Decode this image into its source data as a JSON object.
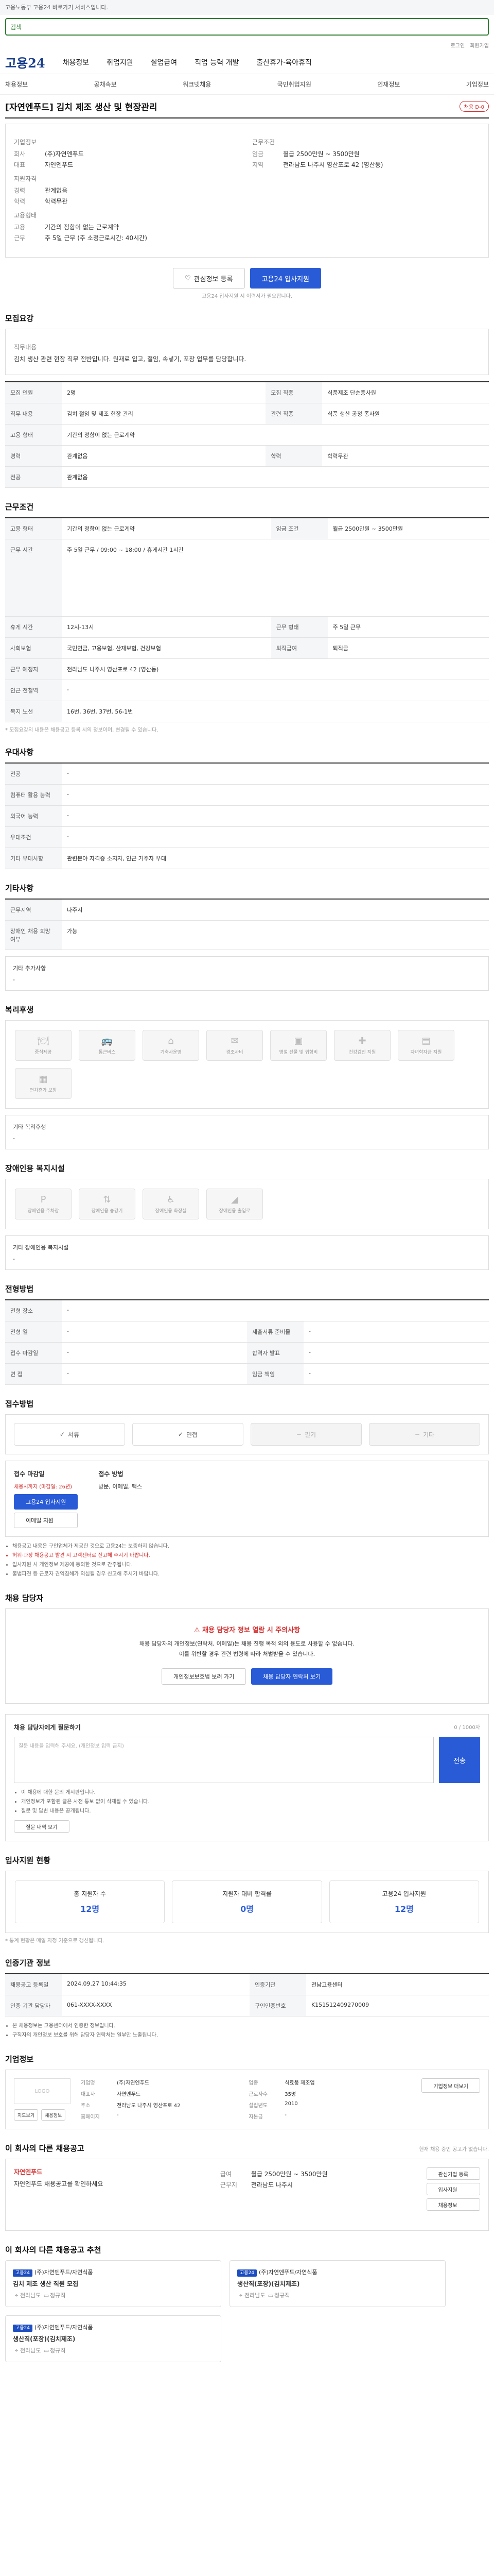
{
  "topbar": {
    "text": "고용노동부 고용24 바로가기 서비스입니다."
  },
  "search": {
    "placeholder": "검색"
  },
  "util": {
    "links": [
      "로그인",
      "회원가입"
    ]
  },
  "brand": {
    "logo": "고용24",
    "nav": [
      "채용정보",
      "취업지원",
      "실업급여",
      "직업 능력 개발",
      "출산휴가·육아휴직"
    ]
  },
  "subnav": [
    "채용정보",
    "공채속보",
    "워크넷채용",
    "국민취업지원",
    "인재정보",
    "기업정보"
  ],
  "job": {
    "title": "[자연엔푸드] 김치 제조 생산 및 현장관리",
    "badge": "채용 D-0",
    "company_label": "기업정보",
    "company_rows": [
      {
        "k": "회사",
        "v": "(주)자연엔푸드"
      },
      {
        "k": "대표",
        "v": "자연엔푸드"
      }
    ],
    "terms_label": "근무조건",
    "terms_rows": [
      {
        "k": "임금",
        "v": "월급 2500만원 ~ 3500만원"
      },
      {
        "k": "지역",
        "v": "전라남도 나주시 영산포로 42 (영산동)"
      }
    ],
    "req_label": "지원자격",
    "req_rows": [
      {
        "k": "경력",
        "v": "관계없음"
      },
      {
        "k": "학력",
        "v": "학력무관"
      }
    ],
    "welfare_label": "고용형태",
    "welfare_rows": [
      {
        "k": "고용",
        "v": "기간의 정함이 없는 근로계약"
      },
      {
        "k": "근무",
        "v": "주 5일 근무 (주 소정근로시간: 40시간)"
      }
    ],
    "scrap_btn": "관심정보 등록",
    "apply_btn": "고용24 입사지원",
    "apply_note": "고용24 입사지원 시 이력서가 필요합니다."
  },
  "sections": {
    "recruit": "모집요강",
    "conditions": "근무조건",
    "benefits": "우대사항",
    "etc": "기타사항",
    "welfare": "복리후생",
    "disability": "장애인용 복지시설",
    "process": "전형방법",
    "method": "접수방법",
    "contact": "채용 담당자",
    "stats": "입사지원 현황",
    "cert": "인증기관 정보",
    "company": "기업정보",
    "other": "이 회사의 다른 채용공고",
    "recommend": "이 회사의 다른 채용공고 추천"
  },
  "recruit": {
    "job_type_label": "직무내용",
    "job_desc": "김치 생산 관련 현장 직무 전반입니다. 원재료 입고, 절임, 속넣기, 포장 업무를 담당합니다.",
    "rows": [
      {
        "k": "모집 인원",
        "v": "2명",
        "k2": "모집 직종",
        "v2": "식품제조 단순종사원"
      },
      {
        "k": "직무 내용",
        "v": "김치 절임 및 제조 현장 관리",
        "k2": "관련 직종",
        "v2": "식품 생산 공정 종사원"
      },
      {
        "k": "고용 형태",
        "v": "기간의 정함이 없는 근로계약"
      },
      {
        "k": "경력",
        "v": "관계없음",
        "k2": "학력",
        "v2": "학력무관"
      },
      {
        "k": "전공",
        "v": "관계없음"
      }
    ]
  },
  "conditions": {
    "rows": [
      {
        "k": "고용 형태",
        "v": "기간의 정함이 없는 근로계약",
        "k2": "임금 조건",
        "v2": "월급 2500만원 ~ 3500만원"
      },
      {
        "k": "근무 시간",
        "v": "주 5일 근무 / 09:00 ~ 18:00 / 휴게시간 1시간"
      },
      {
        "k": "휴게 시간",
        "v": "12시-13시",
        "k2": "근무 형태",
        "v2": "주 5일 근무"
      },
      {
        "k": "사회보험",
        "v": "국민연금, 고용보험, 산재보험, 건강보험",
        "k2": "퇴직급여",
        "v2": "퇴직금"
      },
      {
        "k": "근무 예정지",
        "v": "전라남도 나주시 영산포로 42 (영산동)"
      },
      {
        "k": "인근 전철역",
        "v": "-"
      },
      {
        "k": "복지 노선",
        "v": "16번, 36번, 37번, 56-1번"
      }
    ],
    "note": "* 모집요강의 내용은 채용공고 등록 시의 정보이며, 변경될 수 있습니다."
  },
  "benefits": {
    "rows": [
      {
        "k": "전공",
        "v": "-"
      },
      {
        "k": "컴퓨터 활용 능력",
        "v": "-"
      },
      {
        "k": "외국어 능력",
        "v": "-"
      },
      {
        "k": "우대조건",
        "v": "-"
      },
      {
        "k": "기타 우대사항",
        "v": "관련분야 자격증 소지자, 인근 거주자 우대"
      }
    ]
  },
  "etc": {
    "rows": [
      {
        "k": "근무지역",
        "v": "나주시"
      },
      {
        "k": "장애인 채용 희망 여부",
        "v": "가능"
      }
    ],
    "extra_label": "기타 추가사항",
    "extra_value": "-"
  },
  "welfare": {
    "items": [
      "중식제공",
      "통근버스",
      "기숙사운영",
      "경조사비",
      "명절 선물 및 귀향비",
      "건강검진 지원",
      "자녀학자금 지원",
      "연차휴가 보장"
    ],
    "extra_label": "기타 복리후생",
    "extra_value": "-"
  },
  "disability": {
    "items": [
      "장애인용 주차장",
      "장애인용 승강기",
      "장애인용 화장실",
      "장애인용 출입로"
    ],
    "extra_label": "기타 장애인용 복지시설",
    "extra_value": "-"
  },
  "process": {
    "rows": [
      {
        "k": "전형 장소",
        "v": "-"
      },
      {
        "k": "전형 일",
        "v": "-",
        "k2": "제출서류 준비물",
        "v2": "-"
      },
      {
        "k": "접수 마감일",
        "v": "-",
        "k2": "합격자 발표",
        "v2": "-"
      },
      {
        "k": "면 접",
        "v": "-",
        "k2": "임금 책임",
        "v2": "-"
      }
    ]
  },
  "method": {
    "options": [
      "서류",
      "면접",
      "필기",
      "기타"
    ],
    "submit_label": "접수 마감일",
    "submit_value": "채용시까지 (마감일: 26년)",
    "apply_btn": "고용24 입사지원",
    "email_btn": "이메일 지원",
    "docs_label": "접수 방법",
    "docs_value": "방문, 이메일, 팩스",
    "notes": [
      "채용공고 내용은 구인업체가 제공한 것으로 고용24는 보증하지 않습니다.",
      "허위·과장 채용공고 발견 시 고객센터로 신고해 주시기 바랍니다.",
      "입사지원 시 개인정보 제공에 동의한 것으로 간주됩니다.",
      "불법파견 등 근로자 권익침해가 의심될 경우 신고해 주시기 바랍니다."
    ]
  },
  "contact": {
    "alert": "채용 담당자 정보 열람 시 주의사항",
    "text1": "채용 담당자의 개인정보(연락처, 이메일)는 채용 진행 목적 외의 용도로 사용할 수 없습니다.",
    "text2": "이를 위반할 경우 관련 법령에 따라 처벌받을 수 있습니다.",
    "btn1": "개인정보보호법 보러 가기",
    "btn2": "채용 담당자 연락처 보기"
  },
  "qa": {
    "title": "채용 담당자에게 질문하기",
    "limit": "0 / 1000자",
    "placeholder": "질문 내용을 입력해 주세요. (개인정보 입력 금지)",
    "submit": "전송",
    "notes": [
      "이 채용에 대한 문의 게시판입니다.",
      "개인정보가 포함된 글은 사전 통보 없이 삭제될 수 있습니다.",
      "질문 및 답변 내용은 공개됩니다."
    ],
    "history_btn": "질문 내역 보기"
  },
  "stats": {
    "updated": "기준일자",
    "cards": [
      {
        "label": "총 지원자 수",
        "value": "12명"
      },
      {
        "label": "지원자 대비 합격률",
        "value": "0명"
      },
      {
        "label": "고용24 입사지원",
        "value": "12명"
      }
    ],
    "note": "* 통계 현황은 매일 자정 기준으로 갱신됩니다."
  },
  "cert": {
    "btn": "인증기관 정보 보기",
    "rows": [
      {
        "k": "채용공고 등록일",
        "v": "2024.09.27 10:44:35",
        "k2": "인증기관",
        "v2": "전남고용센터"
      },
      {
        "k": "인증 기관 담당자",
        "v": "061-XXXX-XXXX",
        "k2": "구인인증번호",
        "v2": "K151512409270009"
      }
    ],
    "notes": [
      "본 채용정보는 고용센터에서 인증한 정보입니다.",
      "구직자의 개인정보 보호를 위해 담당자 연락처는 일부만 노출됩니다."
    ]
  },
  "company": {
    "logo": "LOGO",
    "rows": [
      {
        "k": "기업명",
        "v": "(주)자연엔푸드",
        "k2": "업종",
        "v2": "식료품 제조업"
      },
      {
        "k": "대표자",
        "v": "자연엔푸드",
        "k2": "근로자수",
        "v2": "35명"
      },
      {
        "k": "주소",
        "v": "전라남도 나주시 영산포로 42",
        "k2": "설립년도",
        "v2": "2010"
      },
      {
        "k": "홈페이지",
        "v": "-",
        "k2": "자본금",
        "v2": "-"
      }
    ],
    "btn_more": "기업정보 더보기",
    "btn_map": "지도보기",
    "btn_list": "채용정보"
  },
  "other": {
    "header_note": "현재 채용 중인 공고가 없습니다.",
    "left_title": "자연엔푸드",
    "left_text": "자연엔푸드 채용공고를 확인하세요",
    "right_rows": [
      {
        "k": "급여",
        "v": "월급 2500만원 ~ 3500만원"
      },
      {
        "k": "근무지",
        "v": "전라남도 나주시"
      }
    ],
    "btn1": "관심기업 등록",
    "btn2": "입사지원",
    "btn3": "채용정보"
  },
  "recommend": {
    "cards": [
      {
        "tag": "고용24",
        "company": "(주)자연엔푸드/자연식품",
        "title": "김치 제조 생산 직원 모집",
        "loc": "전라남도",
        "type": "정규직"
      },
      {
        "tag": "고용24",
        "company": "(주)자연엔푸드/자연식품",
        "title": "생산직(포장)(김치제조)",
        "loc": "전라남도",
        "type": "정규직"
      },
      {
        "tag": "고용24",
        "company": "(주)자연엔푸드/자연식품",
        "title": "생산직(포장)(김치제조)",
        "loc": "전라남도",
        "type": "정규직"
      }
    ]
  }
}
